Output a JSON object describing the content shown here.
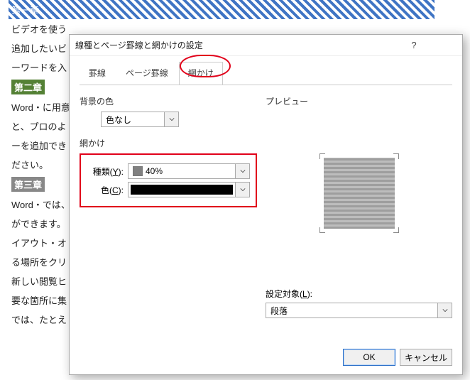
{
  "doc": {
    "ch1": "第一章",
    "l1": "ビデオを使う",
    "l2": "追加したいビ",
    "l3": "ーワードを入",
    "ch2": "第二章",
    "l4": "Word・に用意",
    "l5": "と、プロのよ",
    "l6": "ーを追加でき",
    "l7": "ださい。",
    "ch3": "第三章",
    "l8": "Word・では、",
    "l9": "ができます。",
    "l10": "イアウト・オ",
    "l11": "る場所をクリ",
    "l12": "新しい閲覧ヒ",
    "l13": "要な箇所に集",
    "l14": "では、たとえ"
  },
  "dialog": {
    "title": "線種とページ罫線と網かけの設定",
    "help_label": "?",
    "close_label": "×",
    "tabs": {
      "t1": "罫線",
      "t2": "ページ罫線",
      "t3": "網かけ"
    },
    "bg": {
      "label": "背景の色",
      "value": "色なし"
    },
    "shade": {
      "group": "網かけ",
      "type_label_pre": "種類(",
      "type_label_key": "Y",
      "type_label_post": "):",
      "type_value": "40%",
      "color_label_pre": "色(",
      "color_label_key": "C",
      "color_label_post": "):"
    },
    "preview": {
      "label": "プレビュー"
    },
    "target": {
      "label_pre": "設定対象(",
      "label_key": "L",
      "label_post": "):",
      "value": "段落"
    },
    "buttons": {
      "ok": "OK",
      "cancel": "キャンセル"
    }
  }
}
